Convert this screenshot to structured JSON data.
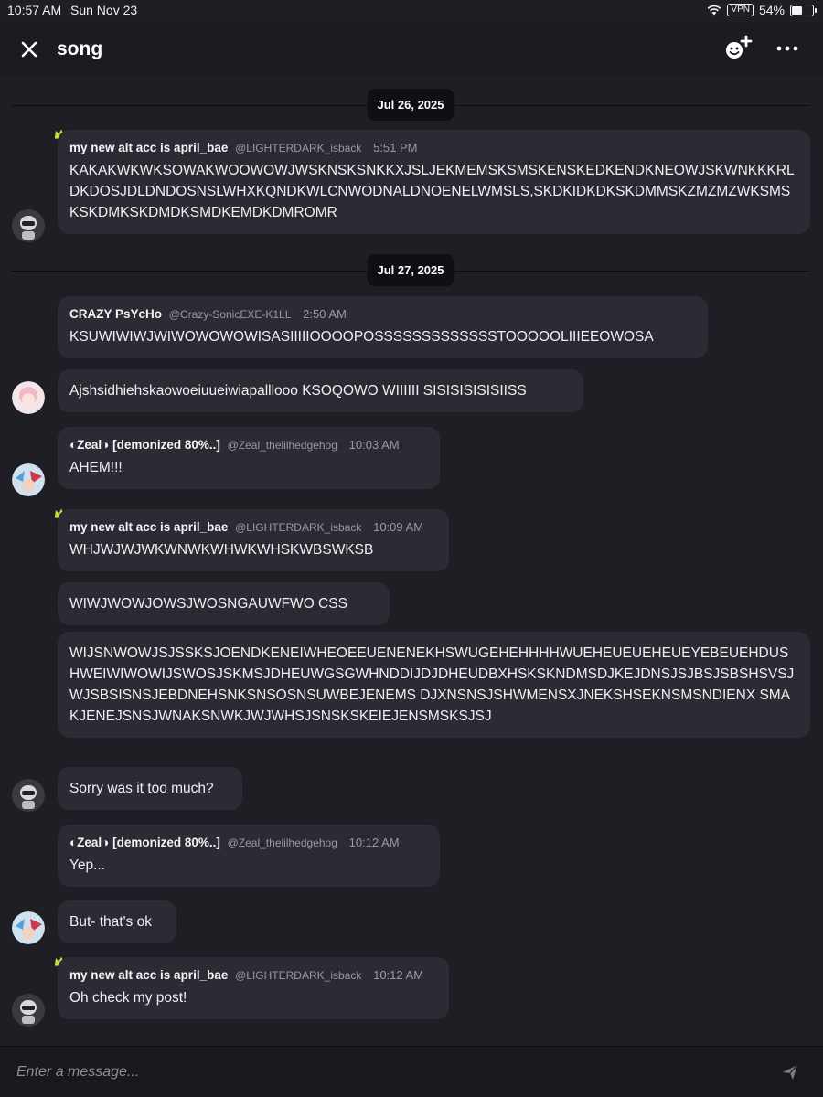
{
  "status": {
    "time": "10:57 AM",
    "date": "Sun Nov 23",
    "vpn": "VPN",
    "battery": "54%",
    "battery_level": 0.54
  },
  "header": {
    "title": "song"
  },
  "dividers": [
    "Jul 26, 2025",
    "Jul 27, 2025"
  ],
  "messages": [
    {
      "name": "my new alt acc is april_bae",
      "handle": "@LIGHTERDARK_isback",
      "time": "5:51 PM",
      "text": "KAKAKWKWKSOWAKWOOWOWJWSKNSKSNKKXJSLJEKMEMSKSMSKENSKEDKENDKNEOWJSKWNKKKRLDKDOSJDLDNDOSNSLWHXKQNDKWLCNWODNALDNOENELWMSLS,SKDKIDKDKSKDMMSKZMZMZWKSMSKSKDMKSKDMDKSMDKEMDKDMROMR"
    },
    {
      "name": "CRAZY PsYcHo",
      "handle": "@Crazy-SonicEXE-K1LL",
      "time": "2:50 AM",
      "text": "KSUWIWIWJWIWOWOWOWISASIIIIIOOOOPOSSSSSSSSSSSSSTOOOOOLIIIEEOWOSA"
    },
    {
      "text": "Ajshsidhiehskaowoeiuueiwiapalllooo KSOQOWO WIIIIII SISISISISISIISS"
    },
    {
      "name": "◐Zeal◑ [demonized 80%..]",
      "handle": "@Zeal_thelilhedgehog",
      "time": "10:03 AM",
      "text": "AHEM!!!"
    },
    {
      "name": "my new alt acc is april_bae",
      "handle": "@LIGHTERDARK_isback",
      "time": "10:09 AM",
      "text": "WHJWJWJWKWNWKWHWKWHSKWBSWKSB"
    },
    {
      "text": "WIWJWOWJOWSJWOSNGAUWFWO CSS"
    },
    {
      "text": "WIJSNWOWJSJSSKSJOENDKENEIWHEOEEUENENEKHSWUGEHEHHHHWUEHEUEUEHEUEYEBEUEHDUSHWEIWIWOWIJSWOSJSKMSJDHEUWGSGWHNDDIJDJDHEUDBXHSKSKNDMSDJKEJDNSJSJBSJSBSHSVSJWJSBSISNSJEBDNEHSNKSNSOSNSUWBEJENEMS DJXNSNSJSHWMENSXJNEKSHSEKNSMSNDIENX SMAKJENEJSNSJWNAKSNWKJWJWHSJSNSKSKEIEJENSMSKSJSJ"
    },
    {
      "text": "Sorry was it too much?"
    },
    {
      "name": "◐Zeal◑ [demonized 80%..]",
      "handle": "@Zeal_thelilhedgehog",
      "time": "10:12 AM",
      "text": "Yep..."
    },
    {
      "text": "But- that's ok"
    },
    {
      "name": "my new alt acc is april_bae",
      "handle": "@LIGHTERDARK_isback",
      "time": "10:12 AM",
      "text": "Oh check my post!"
    }
  ],
  "composer": {
    "placeholder": "Enter a message..."
  },
  "colors": {
    "background": "#1f1e24",
    "bubble": "#2c2b33",
    "crown": "#c6e03a"
  }
}
